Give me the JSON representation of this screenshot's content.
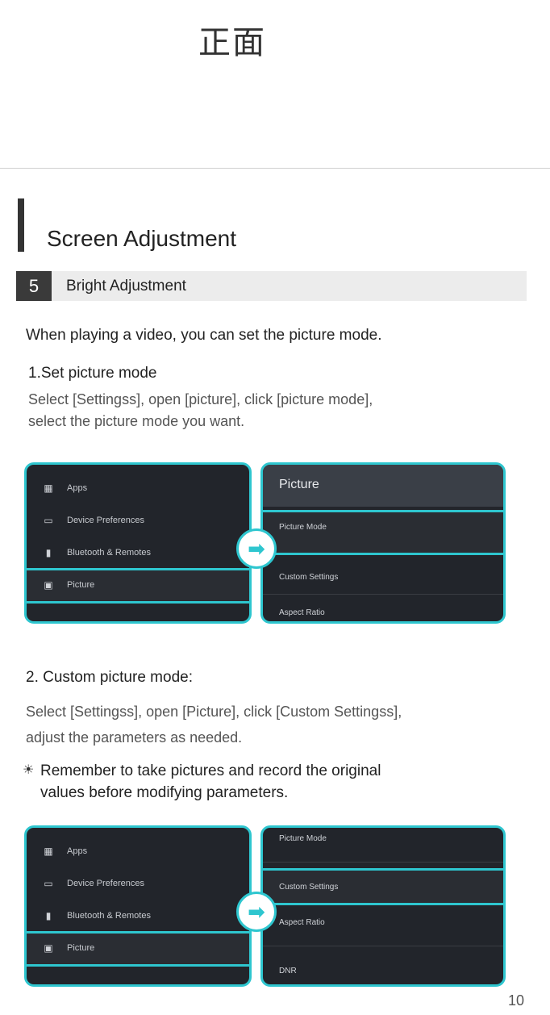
{
  "top_mark": "正面",
  "title": "Screen Adjustment",
  "section": {
    "number": "5",
    "label": "Bright Adjustment"
  },
  "intro": "When playing a video, you can set the picture mode.",
  "step1": {
    "heading": "1.Set picture mode",
    "body_line1": "Select [Settingss], open [picture], click [picture mode],",
    "body_line2": "select the picture mode you want."
  },
  "step2": {
    "heading": "2. Custom picture mode:",
    "body_line1": "Select [Settingss], open [Picture], click [Custom Settingss],",
    "body_line2": "adjust the parameters as needed."
  },
  "tip": {
    "icon": "lightbulb-icon",
    "line1": "Remember to take pictures and record the original",
    "line2": "values before modifying parameters."
  },
  "settings_menu": {
    "items": [
      {
        "label": "Apps",
        "icon": "apps-grid-icon"
      },
      {
        "label": "Device Preferences",
        "icon": "monitor-icon"
      },
      {
        "label": "Bluetooth & Remotes",
        "icon": "remote-icon"
      },
      {
        "label": "Picture",
        "icon": "picture-icon"
      }
    ]
  },
  "picture_panel_1": {
    "title": "Picture",
    "items": [
      {
        "label": "Picture Mode"
      },
      {
        "label": "Custom Settings"
      },
      {
        "label": "Aspect Ratio"
      }
    ]
  },
  "picture_panel_2": {
    "items": [
      {
        "label": "Picture Mode"
      },
      {
        "label": "Custom Settings"
      },
      {
        "label": "Aspect Ratio"
      },
      {
        "label": "DNR"
      }
    ]
  },
  "arrow_glyph": "➡",
  "page_number": "10",
  "colors": {
    "accent": "#2ec6cf",
    "panel_bg": "#22252b"
  }
}
